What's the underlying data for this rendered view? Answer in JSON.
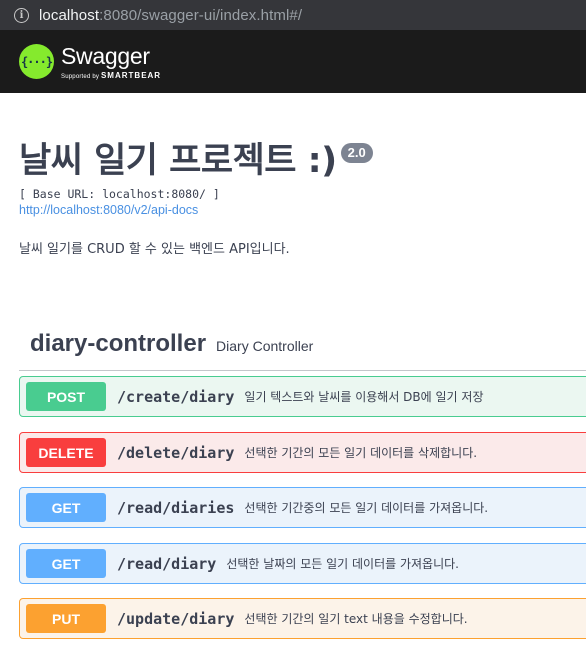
{
  "browser": {
    "url_host": "localhost",
    "url_rest": ":8080/swagger-ui/index.html#/"
  },
  "topbar": {
    "logo_glyph": "{···}",
    "brand": "Swagger",
    "tagline_prefix": "Supported by",
    "tagline_brand": "SMARTBEAR",
    "colors": {
      "background": "#1b1b1b",
      "logo": "#85ea2d"
    }
  },
  "info": {
    "title": "날씨 일기 프로젝트 :)",
    "version": "2.0",
    "base_url": "[ Base URL: localhost:8080/ ]",
    "docs_link": "http://localhost:8080/v2/api-docs",
    "description": "날씨 일기를 CRUD 할 수 있는 백엔드 API입니다."
  },
  "tag": {
    "name": "diary-controller",
    "description": "Diary Controller"
  },
  "operations": [
    {
      "method": "POST",
      "path": "/create/diary",
      "summary": "일기 텍스트와 날씨를 이용해서 DB에 일기 저장",
      "color": "#49cc90"
    },
    {
      "method": "DELETE",
      "path": "/delete/diary",
      "summary": "선택한 기간의 모든 일기 데이터를 삭제합니다.",
      "color": "#f93e3e"
    },
    {
      "method": "GET",
      "path": "/read/diaries",
      "summary": "선택한 기간중의 모든 일기 데이터를 가져옵니다.",
      "color": "#61affe"
    },
    {
      "method": "GET",
      "path": "/read/diary",
      "summary": "선택한 날짜의 모든 일기 데이터를 가져옵니다.",
      "color": "#61affe"
    },
    {
      "method": "PUT",
      "path": "/update/diary",
      "summary": "선택한 기간의 일기 text 내용을 수정합니다.",
      "color": "#fca130"
    }
  ]
}
